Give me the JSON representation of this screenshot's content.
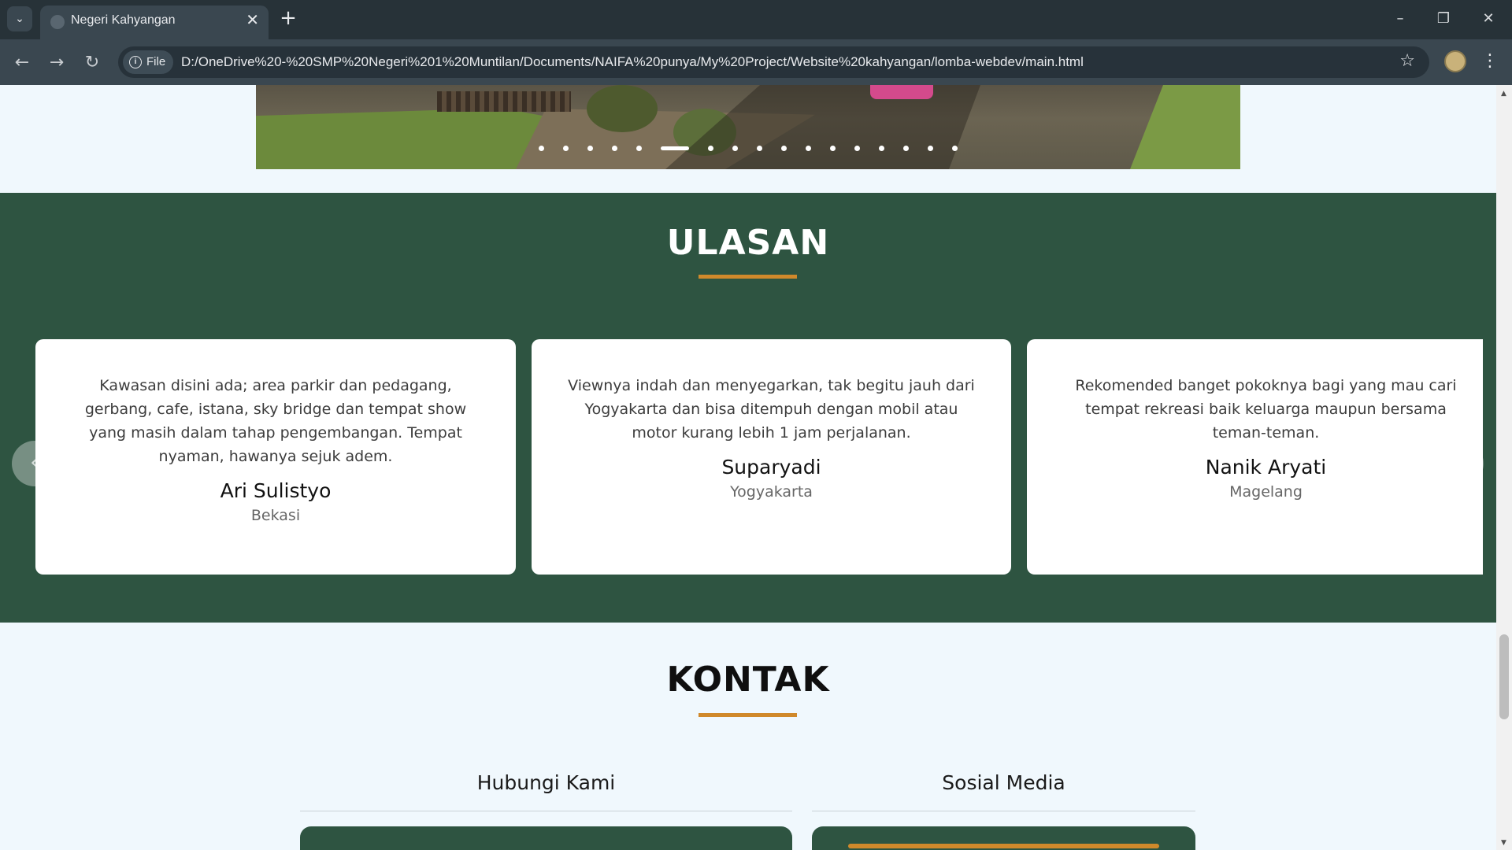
{
  "browser": {
    "tab_title": "Negeri Kahyangan",
    "tab_close": "✕",
    "new_tab": "+",
    "site_chip_label": "File",
    "url": "D:/OneDrive%20-%20SMP%20Negeri%201%20Muntilan/Documents/NAIFA%20punya/My%20Project/Website%20kahyangan/lomba-webdev/main.html",
    "window_controls": {
      "minimize": "–",
      "maximize": "❐",
      "close": "✕"
    },
    "nav": {
      "back": "←",
      "forward": "→",
      "reload": "↻"
    }
  },
  "gallery": {
    "dot_count": 17,
    "active_dot_index": 5
  },
  "ulasan": {
    "title": "ULASAN",
    "reviews": [
      {
        "text": "Kawasan disini ada; area parkir dan pedagang, gerbang, cafe, istana, sky bridge dan tempat show yang masih dalam tahap pengembangan. Tempat nyaman, hawanya sejuk adem.",
        "name": "Ari Sulistyo",
        "city": "Bekasi"
      },
      {
        "text": "Viewnya indah dan menyegarkan, tak begitu jauh dari Yogyakarta dan bisa ditempuh dengan mobil atau motor kurang lebih 1 jam perjalanan.",
        "name": "Suparyadi",
        "city": "Yogyakarta"
      },
      {
        "text": "Rekomended banget pokoknya bagi yang mau cari tempat rekreasi baik keluarga maupun bersama teman-teman.",
        "name": "Nanik Aryati",
        "city": "Magelang"
      }
    ],
    "prev_arrow": "‹",
    "next_arrow": "›"
  },
  "kontak": {
    "title": "KONTAK",
    "hubungi_title": "Hubungi Kami",
    "sosial_title": "Sosial Media"
  },
  "colors": {
    "section_green": "#2e5441",
    "accent_orange": "#d0892b",
    "page_bg": "#f0f8fd"
  }
}
